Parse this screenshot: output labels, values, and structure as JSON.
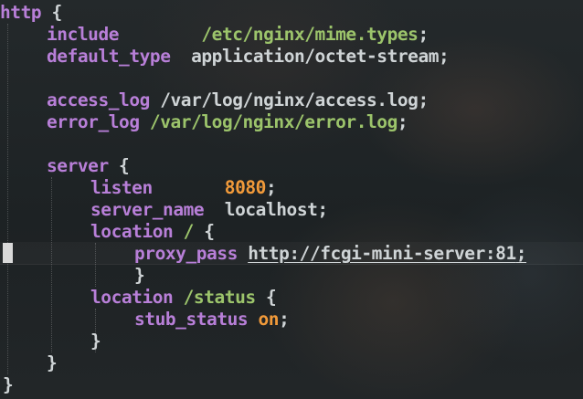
{
  "code": {
    "l1": {
      "keyword": "http",
      "brace": " {"
    },
    "l2": {
      "directive": "include",
      "value": "/etc/nginx/mime.types",
      "end": ";"
    },
    "l3": {
      "directive": "default_type",
      "value": "application/octet-stream",
      "end": ";"
    },
    "l4": {
      "directive": "access_log",
      "value": "/var/log/nginx/access.log",
      "end": ";"
    },
    "l5": {
      "directive": "error_log",
      "value": "/var/log/nginx/error.log",
      "end": ";"
    },
    "l6": {
      "keyword": "server",
      "brace": " {"
    },
    "l7": {
      "directive": "listen",
      "value": "8080",
      "end": ";"
    },
    "l8": {
      "directive": "server_name",
      "value": "localhost",
      "end": ";"
    },
    "l9": {
      "keyword": "location",
      "path": "/",
      "brace": " {"
    },
    "l10": {
      "directive": "proxy_pass",
      "value": "http://fcgi-mini-server:81",
      "end": ";"
    },
    "l11": {
      "brace": "}"
    },
    "l12": {
      "keyword": "location",
      "path": "/status",
      "brace": " {"
    },
    "l13": {
      "directive": "stub_status",
      "value": "on",
      "end": ";"
    },
    "l14": {
      "brace": "}"
    },
    "l15": {
      "brace": "}"
    },
    "l16": {
      "brace": "}"
    }
  },
  "colors": {
    "keyword": "#b87fd8",
    "string": "#9cc46b",
    "number": "#f19a3a",
    "text": "#cfd4d6",
    "cursor": "#d9d9d9"
  }
}
